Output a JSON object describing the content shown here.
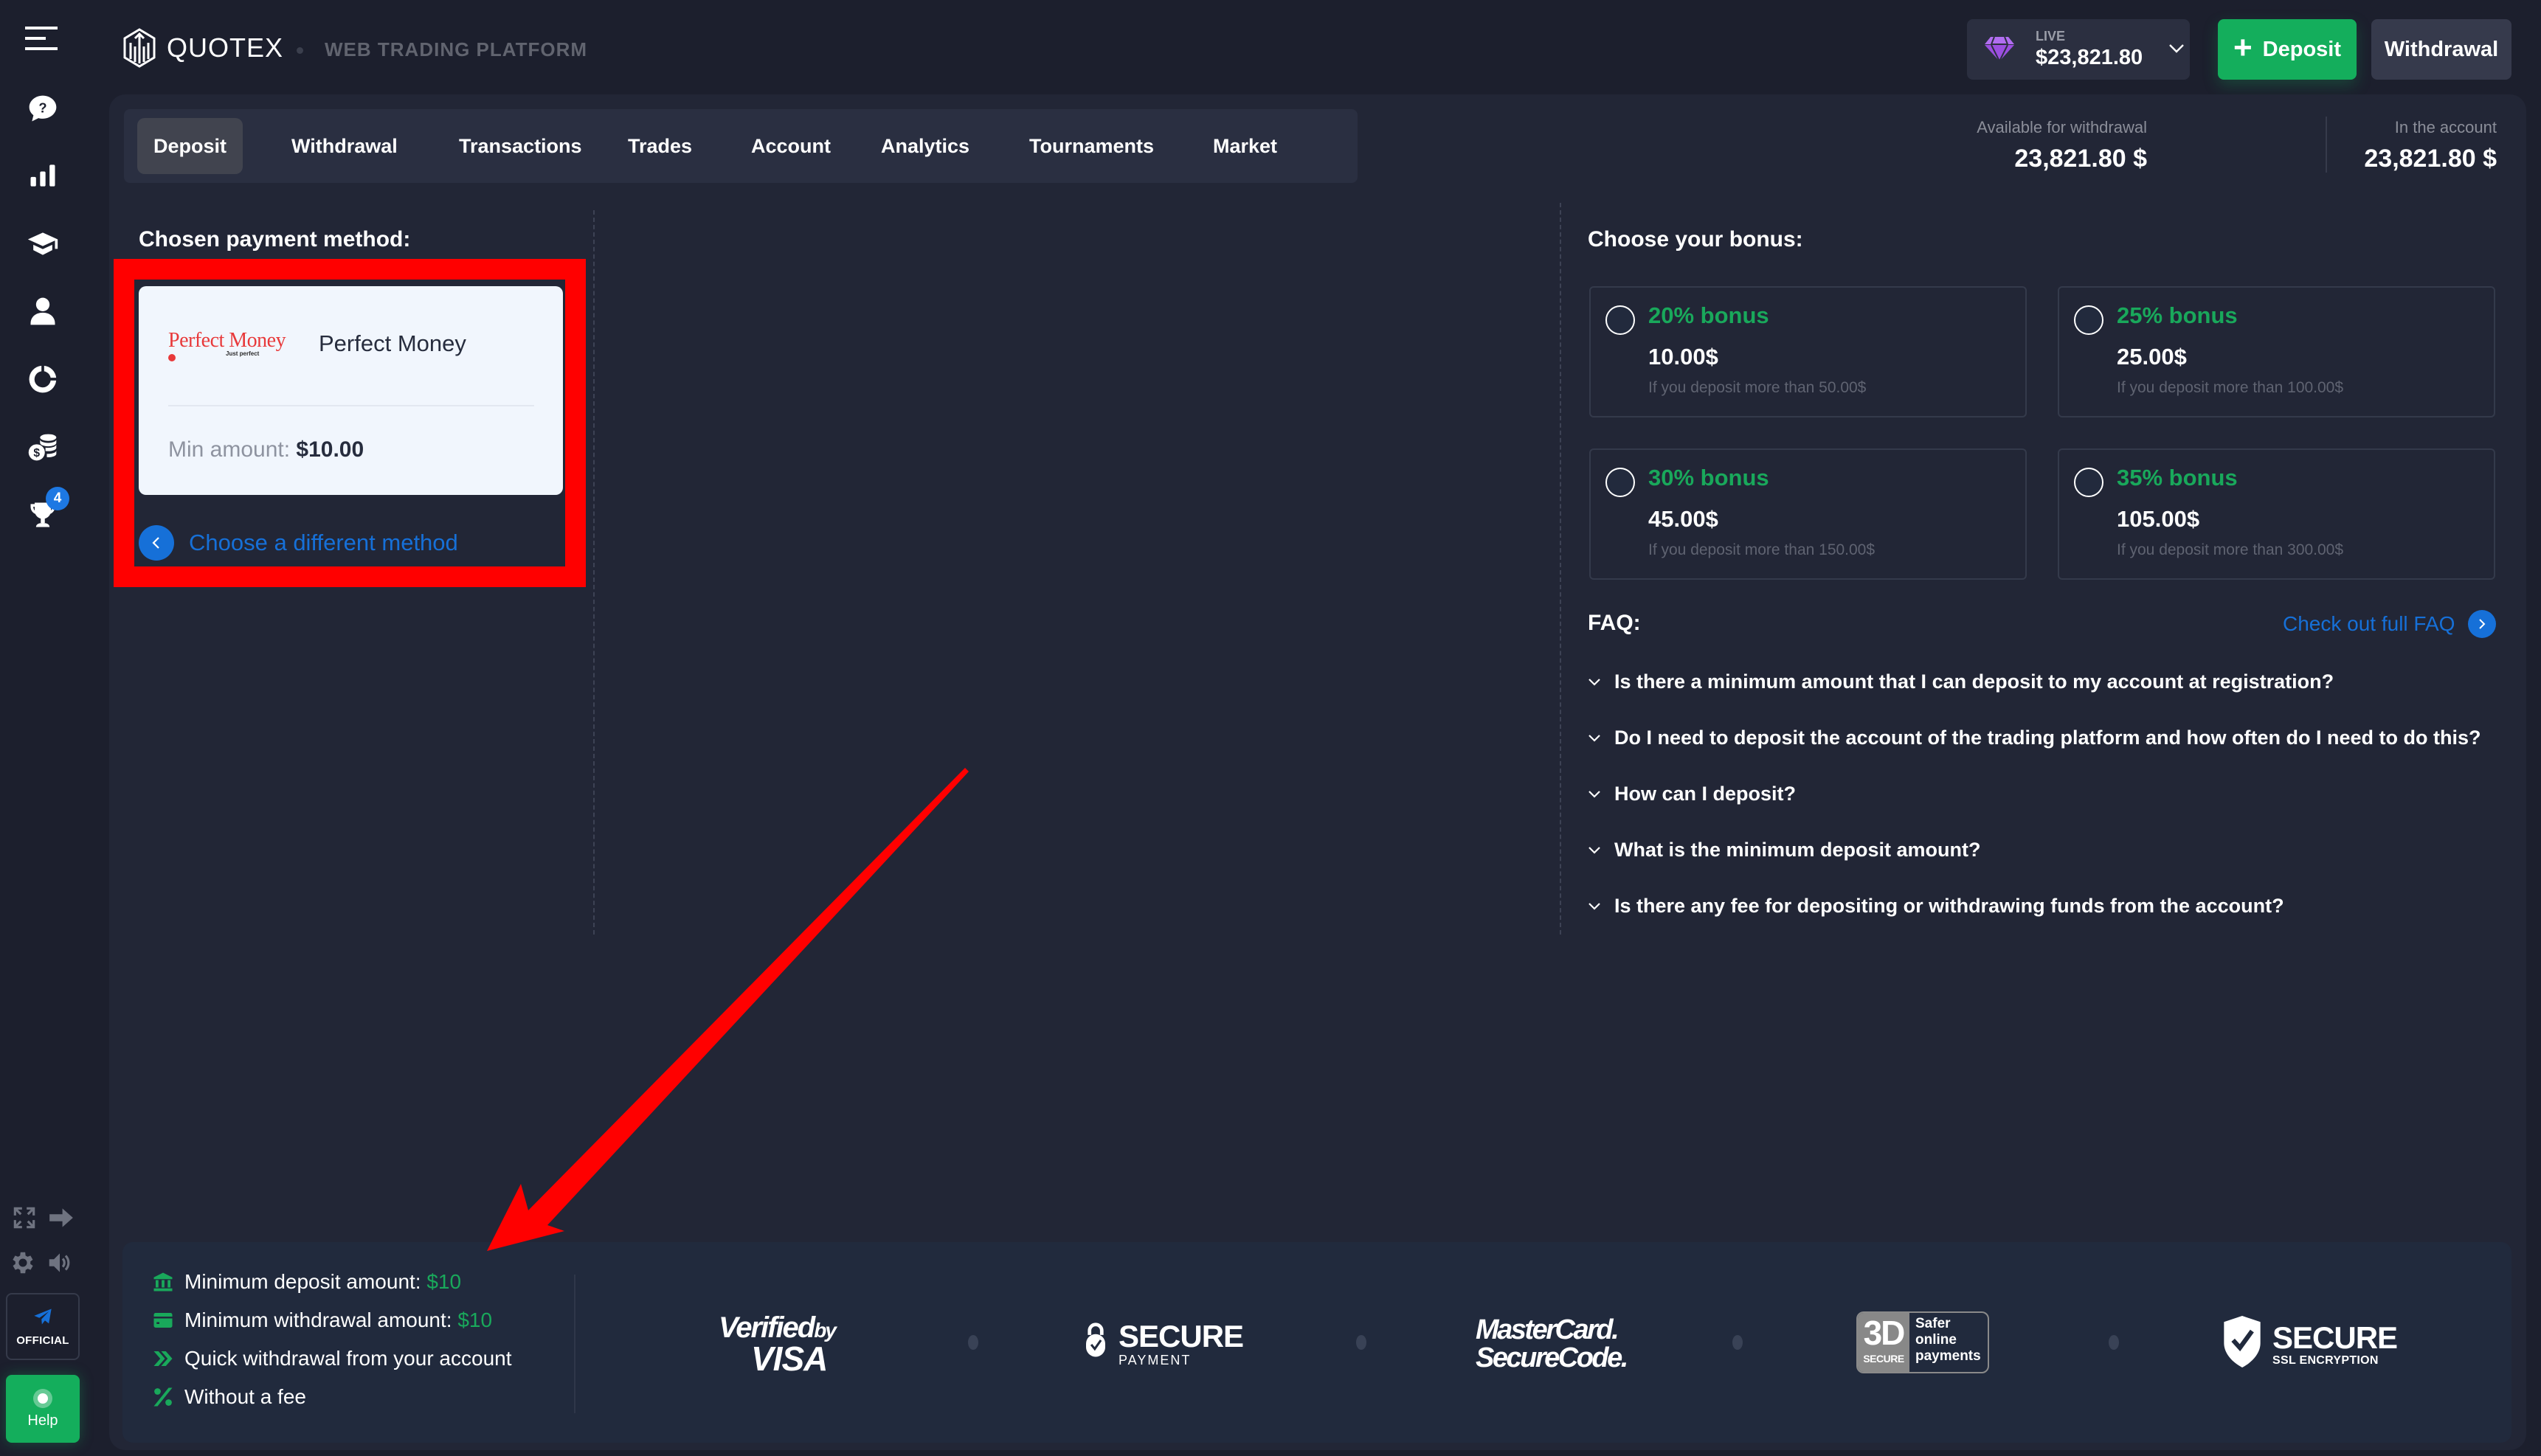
{
  "sidebar": {
    "menu_icon": "hamburger-menu-icon",
    "items": [
      {
        "name": "support",
        "icon": "question-chat-icon"
      },
      {
        "name": "analytics",
        "icon": "bar-chart-icon"
      },
      {
        "name": "education",
        "icon": "graduation-cap-icon"
      },
      {
        "name": "account",
        "icon": "user-icon"
      },
      {
        "name": "market",
        "icon": "donut-chart-icon"
      },
      {
        "name": "deposit",
        "icon": "coins-dollar-icon"
      },
      {
        "name": "tournaments",
        "icon": "trophy-icon",
        "badge": "4"
      }
    ],
    "bottom": {
      "fullscreen_icon": "fullscreen-icon",
      "logout_icon": "arrow-right-icon",
      "settings_icon": "gear-icon",
      "sound_icon": "volume-icon",
      "official_label": "OFFICIAL",
      "help_label": "Help"
    }
  },
  "header": {
    "logo_text": "QUOTEX",
    "platform_label": "WEB TRADING PLATFORM",
    "account": {
      "type": "LIVE",
      "balance": "$23,821.80"
    },
    "deposit_button": "Deposit",
    "withdrawal_button": "Withdrawal"
  },
  "tabs": [
    {
      "label": "Deposit",
      "active": true
    },
    {
      "label": "Withdrawal",
      "active": false
    },
    {
      "label": "Transactions",
      "active": false
    },
    {
      "label": "Trades",
      "active": false
    },
    {
      "label": "Account",
      "active": false
    },
    {
      "label": "Analytics",
      "active": false
    },
    {
      "label": "Tournaments",
      "active": false
    },
    {
      "label": "Market",
      "active": false
    }
  ],
  "balances": {
    "available_label": "Available for withdrawal",
    "available_value": "23,821.80 $",
    "account_label": "In the account",
    "account_value": "23,821.80 $"
  },
  "payment": {
    "section_title": "Chosen payment method:",
    "logo_text": "Perfect Money",
    "logo_tagline": "Just perfect",
    "method_name": "Perfect Money",
    "min_label": "Min amount:",
    "min_value": "$10.00",
    "choose_different": "Choose a different method"
  },
  "bonus": {
    "section_title": "Choose your bonus:",
    "options": [
      {
        "title": "20% bonus",
        "amount": "10.00$",
        "condition": "If you deposit more than 50.00$",
        "selected": false
      },
      {
        "title": "25% bonus",
        "amount": "25.00$",
        "condition": "If you deposit more than 100.00$",
        "selected": false
      },
      {
        "title": "30% bonus",
        "amount": "45.00$",
        "condition": "If you deposit more than 150.00$",
        "selected": false
      },
      {
        "title": "35% bonus",
        "amount": "105.00$",
        "condition": "If you deposit more than 300.00$",
        "selected": false
      }
    ]
  },
  "faq": {
    "title": "FAQ:",
    "full_link": "Check out full FAQ",
    "items": [
      "Is there a minimum amount that I can deposit to my account at registration?",
      "Do I need to deposit the account of the trading platform and how often do I need to do this?",
      "How can I deposit?",
      "What is the minimum deposit amount?",
      "Is there any fee for depositing or withdrawing funds from the account?"
    ]
  },
  "footer": {
    "features": [
      {
        "icon": "bank-icon",
        "text": "Minimum deposit amount: ",
        "highlight": "$10"
      },
      {
        "icon": "credit-card-icon",
        "text": "Minimum withdrawal amount: ",
        "highlight": "$10"
      },
      {
        "icon": "double-chevron-icon",
        "text": "Quick withdrawal from your account",
        "highlight": ""
      },
      {
        "icon": "percent-icon",
        "text": "Without a fee",
        "highlight": ""
      }
    ],
    "trust_badges": [
      {
        "name": "verified-by-visa",
        "line1": "Verified",
        "line1b": "by",
        "line2": "VISA"
      },
      {
        "name": "secure-payment",
        "line1": "SECURE",
        "line2": "PAYMENT"
      },
      {
        "name": "mastercard-securecode",
        "line1": "MasterCard.",
        "line2": "SecureCode."
      },
      {
        "name": "3d-secure",
        "big": "3D",
        "small": "SECURE",
        "text1": "Safer",
        "text2": "online",
        "text3": "payments"
      },
      {
        "name": "ssl-encryption",
        "line1": "SECURE",
        "line2": "SSL ENCRYPTION"
      }
    ]
  },
  "colors": {
    "background": "#1c1f2d",
    "panel": "#222636",
    "accent_green": "#14ae5c",
    "bonus_green": "#19a85b",
    "link_blue": "#1670d8",
    "annotation_red": "#ff0000",
    "premium_purple": "#a55eea"
  }
}
